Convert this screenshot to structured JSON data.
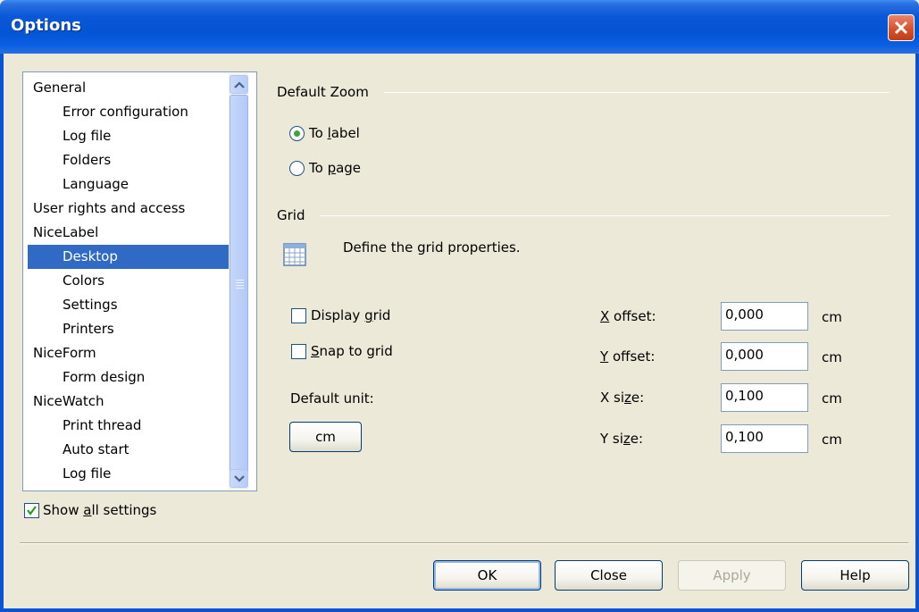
{
  "window": {
    "title": "Options"
  },
  "tree": {
    "items": [
      {
        "label": "General",
        "level": 0
      },
      {
        "label": "Error configuration",
        "level": 1
      },
      {
        "label": "Log file",
        "level": 1
      },
      {
        "label": "Folders",
        "level": 1
      },
      {
        "label": "Language",
        "level": 1
      },
      {
        "label": "User rights and access",
        "level": 0
      },
      {
        "label": "NiceLabel",
        "level": 0
      },
      {
        "label": "Desktop",
        "level": 1,
        "selected": true
      },
      {
        "label": "Colors",
        "level": 1
      },
      {
        "label": "Settings",
        "level": 1
      },
      {
        "label": "Printers",
        "level": 1
      },
      {
        "label": "NiceForm",
        "level": 0
      },
      {
        "label": "Form design",
        "level": 1
      },
      {
        "label": "NiceWatch",
        "level": 0
      },
      {
        "label": "Print thread",
        "level": 1
      },
      {
        "label": "Auto start",
        "level": 1
      },
      {
        "label": "Log file",
        "level": 1
      }
    ],
    "selection_color": "#316ac5"
  },
  "show_all": {
    "label_pre": "Show ",
    "label_accel": "a",
    "label_post": "ll settings",
    "checked": true
  },
  "zoom": {
    "heading": "Default Zoom",
    "to_label": {
      "pre": "To ",
      "accel": "l",
      "post": "abel",
      "selected": true
    },
    "to_page": {
      "pre": "To ",
      "accel": "p",
      "post": "age",
      "selected": false
    }
  },
  "grid": {
    "heading": "Grid",
    "description": "Define the grid properties.",
    "display_grid": {
      "pre": "Display ",
      "accel": "g",
      "post": "rid",
      "checked": false
    },
    "snap_to_grid": {
      "pre": "",
      "accel": "S",
      "post": "nap to grid",
      "checked": false
    },
    "default_unit_label": "Default unit:",
    "unit_button": "cm",
    "x_offset": {
      "pre": "",
      "accel": "X",
      "post": " offset:",
      "value": "0,000",
      "unit": "cm"
    },
    "y_offset": {
      "pre": "",
      "accel": "Y",
      "post": " offset:",
      "value": "0,000",
      "unit": "cm"
    },
    "x_size": {
      "pre": "X si",
      "accel": "z",
      "post": "e:",
      "value": "0,100",
      "unit": "cm"
    },
    "y_size": {
      "pre": "Y si",
      "accel": "z",
      "post": "e:",
      "value": "0,100",
      "unit": "cm"
    }
  },
  "buttons": {
    "ok": "OK",
    "close": "Close",
    "apply": "Apply",
    "help": "Help"
  },
  "colors": {
    "title_bar": "#0454d3",
    "dialog_bg": "#ece9d8",
    "radio_dot": "#3ba43b",
    "close_button": "#d9512c"
  }
}
